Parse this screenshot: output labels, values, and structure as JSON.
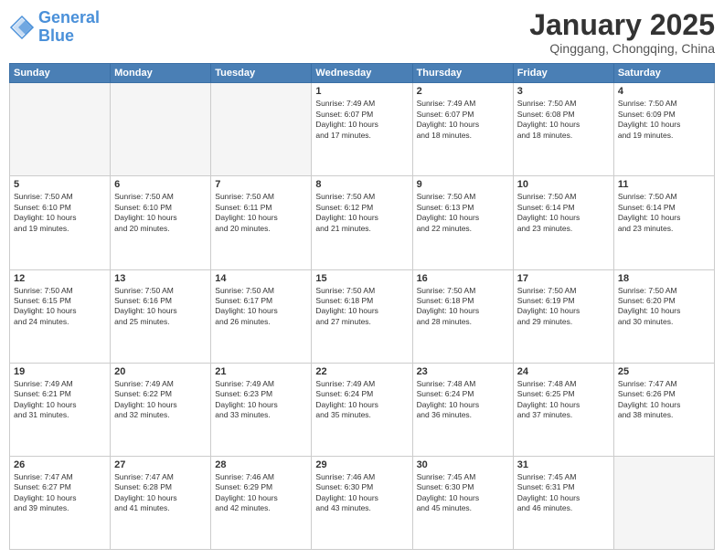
{
  "header": {
    "logo_line1": "General",
    "logo_line2": "Blue",
    "month_title": "January 2025",
    "location": "Qinggang, Chongqing, China"
  },
  "weekdays": [
    "Sunday",
    "Monday",
    "Tuesday",
    "Wednesday",
    "Thursday",
    "Friday",
    "Saturday"
  ],
  "weeks": [
    [
      {
        "day": "",
        "empty": true
      },
      {
        "day": "",
        "empty": true
      },
      {
        "day": "",
        "empty": true
      },
      {
        "day": "1",
        "info": "Sunrise: 7:49 AM\nSunset: 6:07 PM\nDaylight: 10 hours\nand 17 minutes."
      },
      {
        "day": "2",
        "info": "Sunrise: 7:49 AM\nSunset: 6:07 PM\nDaylight: 10 hours\nand 18 minutes."
      },
      {
        "day": "3",
        "info": "Sunrise: 7:50 AM\nSunset: 6:08 PM\nDaylight: 10 hours\nand 18 minutes."
      },
      {
        "day": "4",
        "info": "Sunrise: 7:50 AM\nSunset: 6:09 PM\nDaylight: 10 hours\nand 19 minutes."
      }
    ],
    [
      {
        "day": "5",
        "info": "Sunrise: 7:50 AM\nSunset: 6:10 PM\nDaylight: 10 hours\nand 19 minutes."
      },
      {
        "day": "6",
        "info": "Sunrise: 7:50 AM\nSunset: 6:10 PM\nDaylight: 10 hours\nand 20 minutes."
      },
      {
        "day": "7",
        "info": "Sunrise: 7:50 AM\nSunset: 6:11 PM\nDaylight: 10 hours\nand 20 minutes."
      },
      {
        "day": "8",
        "info": "Sunrise: 7:50 AM\nSunset: 6:12 PM\nDaylight: 10 hours\nand 21 minutes."
      },
      {
        "day": "9",
        "info": "Sunrise: 7:50 AM\nSunset: 6:13 PM\nDaylight: 10 hours\nand 22 minutes."
      },
      {
        "day": "10",
        "info": "Sunrise: 7:50 AM\nSunset: 6:14 PM\nDaylight: 10 hours\nand 23 minutes."
      },
      {
        "day": "11",
        "info": "Sunrise: 7:50 AM\nSunset: 6:14 PM\nDaylight: 10 hours\nand 23 minutes."
      }
    ],
    [
      {
        "day": "12",
        "info": "Sunrise: 7:50 AM\nSunset: 6:15 PM\nDaylight: 10 hours\nand 24 minutes."
      },
      {
        "day": "13",
        "info": "Sunrise: 7:50 AM\nSunset: 6:16 PM\nDaylight: 10 hours\nand 25 minutes."
      },
      {
        "day": "14",
        "info": "Sunrise: 7:50 AM\nSunset: 6:17 PM\nDaylight: 10 hours\nand 26 minutes."
      },
      {
        "day": "15",
        "info": "Sunrise: 7:50 AM\nSunset: 6:18 PM\nDaylight: 10 hours\nand 27 minutes."
      },
      {
        "day": "16",
        "info": "Sunrise: 7:50 AM\nSunset: 6:18 PM\nDaylight: 10 hours\nand 28 minutes."
      },
      {
        "day": "17",
        "info": "Sunrise: 7:50 AM\nSunset: 6:19 PM\nDaylight: 10 hours\nand 29 minutes."
      },
      {
        "day": "18",
        "info": "Sunrise: 7:50 AM\nSunset: 6:20 PM\nDaylight: 10 hours\nand 30 minutes."
      }
    ],
    [
      {
        "day": "19",
        "info": "Sunrise: 7:49 AM\nSunset: 6:21 PM\nDaylight: 10 hours\nand 31 minutes."
      },
      {
        "day": "20",
        "info": "Sunrise: 7:49 AM\nSunset: 6:22 PM\nDaylight: 10 hours\nand 32 minutes."
      },
      {
        "day": "21",
        "info": "Sunrise: 7:49 AM\nSunset: 6:23 PM\nDaylight: 10 hours\nand 33 minutes."
      },
      {
        "day": "22",
        "info": "Sunrise: 7:49 AM\nSunset: 6:24 PM\nDaylight: 10 hours\nand 35 minutes."
      },
      {
        "day": "23",
        "info": "Sunrise: 7:48 AM\nSunset: 6:24 PM\nDaylight: 10 hours\nand 36 minutes."
      },
      {
        "day": "24",
        "info": "Sunrise: 7:48 AM\nSunset: 6:25 PM\nDaylight: 10 hours\nand 37 minutes."
      },
      {
        "day": "25",
        "info": "Sunrise: 7:47 AM\nSunset: 6:26 PM\nDaylight: 10 hours\nand 38 minutes."
      }
    ],
    [
      {
        "day": "26",
        "info": "Sunrise: 7:47 AM\nSunset: 6:27 PM\nDaylight: 10 hours\nand 39 minutes."
      },
      {
        "day": "27",
        "info": "Sunrise: 7:47 AM\nSunset: 6:28 PM\nDaylight: 10 hours\nand 41 minutes."
      },
      {
        "day": "28",
        "info": "Sunrise: 7:46 AM\nSunset: 6:29 PM\nDaylight: 10 hours\nand 42 minutes."
      },
      {
        "day": "29",
        "info": "Sunrise: 7:46 AM\nSunset: 6:30 PM\nDaylight: 10 hours\nand 43 minutes."
      },
      {
        "day": "30",
        "info": "Sunrise: 7:45 AM\nSunset: 6:30 PM\nDaylight: 10 hours\nand 45 minutes."
      },
      {
        "day": "31",
        "info": "Sunrise: 7:45 AM\nSunset: 6:31 PM\nDaylight: 10 hours\nand 46 minutes."
      },
      {
        "day": "",
        "empty": true
      }
    ]
  ]
}
